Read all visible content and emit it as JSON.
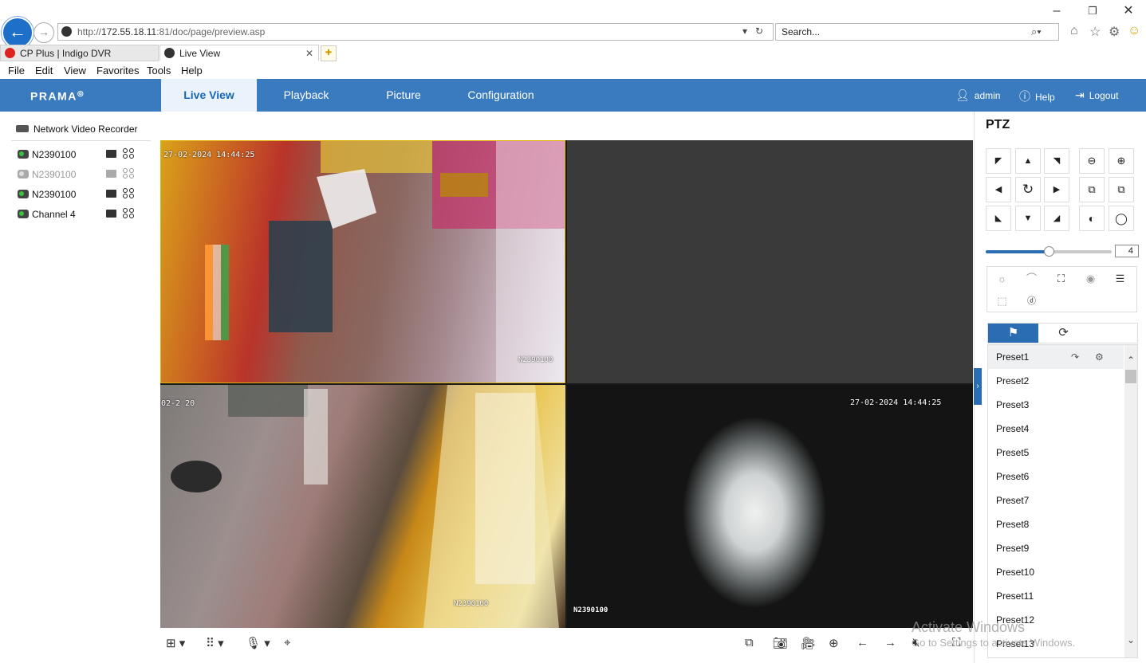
{
  "browser": {
    "address": {
      "prefix": "http://",
      "host": "172.55.18.11",
      "rest": ":81/doc/page/preview.asp"
    },
    "search_placeholder": "Search...",
    "tabs": [
      {
        "title": "CP Plus | Indigo DVR"
      },
      {
        "title": "Live View"
      }
    ],
    "menu": [
      "File",
      "Edit",
      "View",
      "Favorites",
      "Tools",
      "Help"
    ]
  },
  "app": {
    "logo": "PRAMA",
    "nav": [
      "Live View",
      "Playback",
      "Picture",
      "Configuration"
    ],
    "active_nav": "Live View",
    "user": {
      "name": "admin",
      "help": "Help",
      "logout": "Logout"
    }
  },
  "tree": {
    "root": "Network Video Recorder",
    "channels": [
      {
        "label": "N2390100",
        "online": true
      },
      {
        "label": "N2390100",
        "online": false
      },
      {
        "label": "N2390100",
        "online": true
      },
      {
        "label": "Channel 4",
        "online": true
      }
    ]
  },
  "video": {
    "tiles": [
      {
        "timestamp": "27-02-2024 14:44:25",
        "name": "N2390100"
      },
      {
        "timestamp": "",
        "name": ""
      },
      {
        "timestamp": "02-2 20",
        "name": "N2390100"
      },
      {
        "timestamp": "27-02-2024 14:44:25",
        "name": "N2390100"
      }
    ]
  },
  "ptz": {
    "title": "PTZ",
    "speed": 4,
    "speed_fraction": 0.5,
    "presets": [
      "Preset1",
      "Preset2",
      "Preset3",
      "Preset4",
      "Preset5",
      "Preset6",
      "Preset7",
      "Preset8",
      "Preset9",
      "Preset10",
      "Preset11",
      "Preset12",
      "Preset13"
    ],
    "selected_preset": "Preset1"
  },
  "watermark": {
    "line1": "Activate Windows",
    "line2": "Go to Settings to activate Windows."
  },
  "colors": {
    "app_bar": "#3a7bbf",
    "accent": "#2a6db3",
    "selected_tile_border": "#e0b000"
  }
}
